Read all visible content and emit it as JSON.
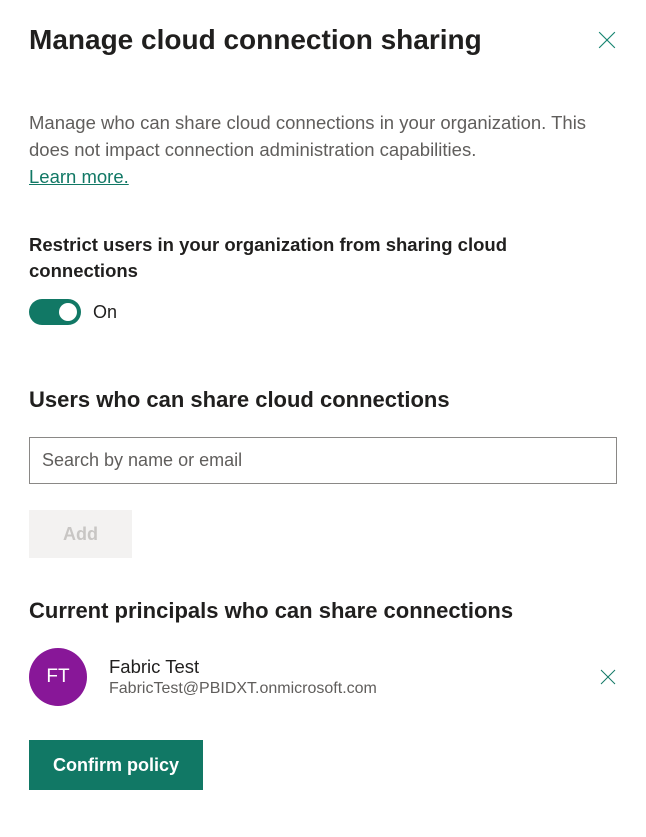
{
  "dialog": {
    "title": "Manage cloud connection sharing",
    "description": "Manage who can share cloud connections in your organization. This does not impact connection administration capabilities.",
    "learn_more": "Learn more."
  },
  "restrict": {
    "label": "Restrict users in your organization from sharing cloud connections",
    "toggle_state": "On"
  },
  "users_section": {
    "heading": "Users who can share cloud connections",
    "search_placeholder": "Search by name or email",
    "add_label": "Add"
  },
  "principals_section": {
    "heading": "Current principals who can share connections",
    "items": [
      {
        "initials": "FT",
        "name": "Fabric Test",
        "email": "FabricTest@PBIDXT.onmicrosoft.com",
        "avatar_color": "#881798"
      }
    ]
  },
  "actions": {
    "confirm_label": "Confirm policy"
  }
}
